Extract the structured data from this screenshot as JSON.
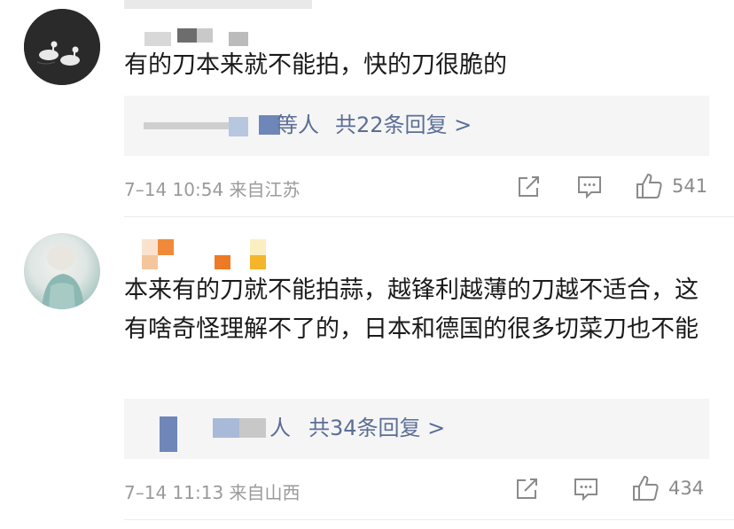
{
  "comments": [
    {
      "text": "有的刀本来就不能拍，快的刀很脆的",
      "reply_suffix": "等人",
      "reply_count": "共22条回复 >",
      "timestamp": "7–14 10:54",
      "location": "来自江苏",
      "likes": "541"
    },
    {
      "text": "本来有的刀就不能拍蒜，越锋利越薄的刀越不适合，这有啥奇怪理解不了的，日本和德国的很多切菜刀也不能",
      "reply_suffix": "人",
      "reply_count": "共34条回复 >",
      "timestamp": "7–14 11:13",
      "location": "来自山西",
      "likes": "434"
    }
  ],
  "colors": {
    "reply_link": "#5b6e95",
    "meta_text": "#9a9a9a",
    "reply_bg": "#f5f5f5"
  }
}
